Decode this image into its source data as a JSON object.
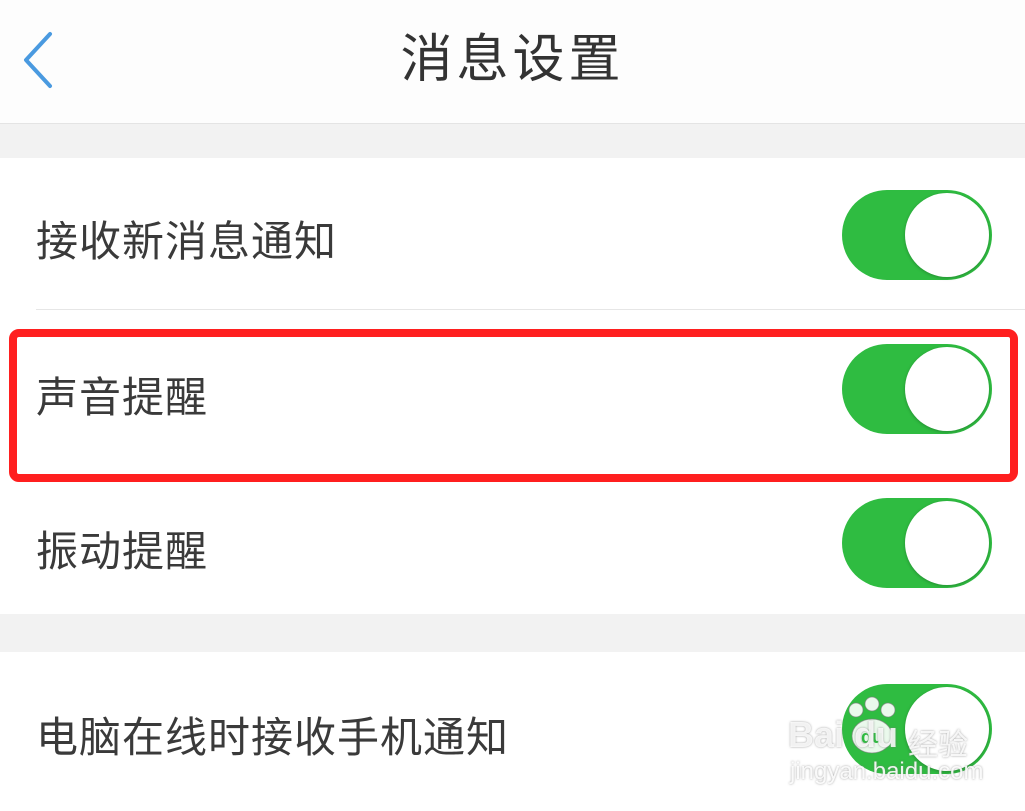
{
  "header": {
    "title": "消息设置",
    "back_icon": "chevron-left-icon"
  },
  "colors": {
    "toggle_on": "#2fbc41",
    "back_icon": "#4a9ae0",
    "highlight": "#ff1f1f"
  },
  "settings": {
    "group1": [
      {
        "label": "接收新消息通知",
        "enabled": true
      },
      {
        "label": "声音提醒",
        "enabled": true,
        "highlighted": true
      },
      {
        "label": "振动提醒",
        "enabled": true
      }
    ],
    "group2": [
      {
        "label": "电脑在线时接收手机通知",
        "enabled": true
      }
    ]
  },
  "watermark": {
    "logo": "Bai du",
    "logo_badge": "du",
    "sub": "经验",
    "url": "jingyan.baidu.com"
  }
}
